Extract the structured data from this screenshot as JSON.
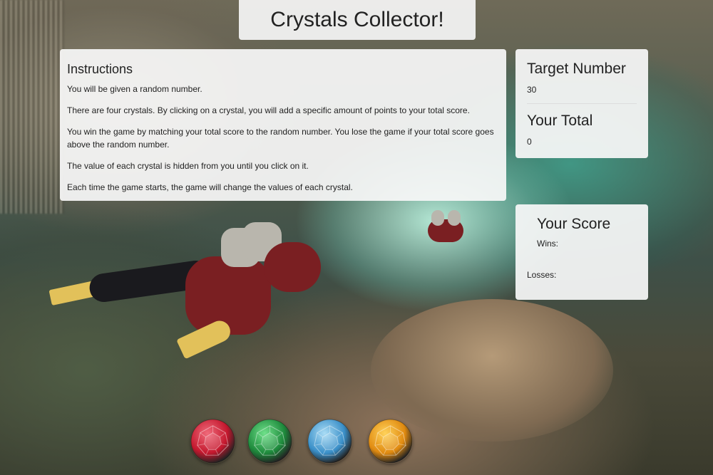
{
  "title": "Crystals Collector!",
  "instructions": {
    "heading": "Instructions",
    "lines": [
      "You will be given a random number.",
      "There are four crystals. By clicking on a crystal, you will add a specific amount of points to your total score.",
      "You win the game by matching your total score to the random number. You lose the game if your total score goes above the random number.",
      "The value of each crystal is hidden from you until you click on it.",
      "Each time the game starts, the game will change the values of each crystal."
    ]
  },
  "target": {
    "heading": "Target Number",
    "value": "30"
  },
  "total": {
    "heading": "Your Total",
    "value": "0"
  },
  "score": {
    "heading": "Your Score",
    "wins_label": "Wins:",
    "losses_label": "Losses:"
  },
  "crystals": [
    {
      "name": "red-crystal",
      "color": "#c4182e",
      "light": "#f06a7a"
    },
    {
      "name": "green-crystal",
      "color": "#1e8a3c",
      "light": "#6fe08a"
    },
    {
      "name": "blue-crystal",
      "color": "#3a8fc8",
      "light": "#a9dcf5"
    },
    {
      "name": "yellow-crystal",
      "color": "#e08a10",
      "light": "#ffd25a"
    }
  ]
}
